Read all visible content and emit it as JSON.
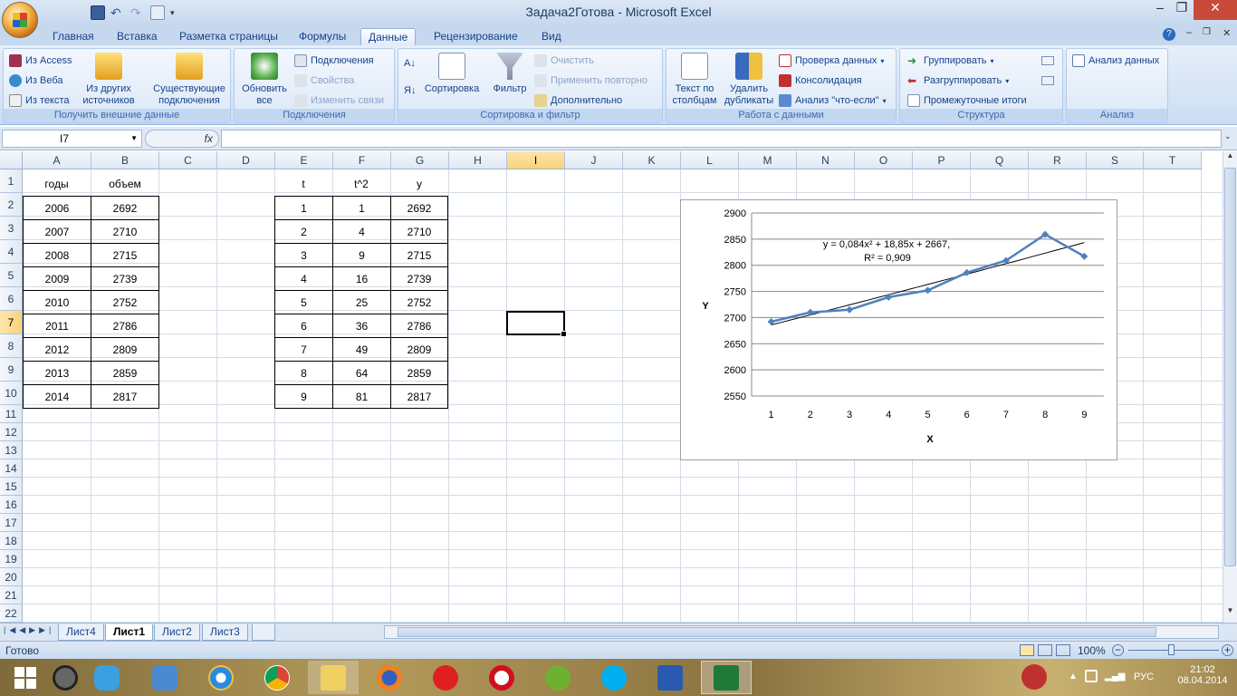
{
  "title": "Задача2Готова - Microsoft Excel",
  "tabs": [
    "Главная",
    "Вставка",
    "Разметка страницы",
    "Формулы",
    "Данные",
    "Рецензирование",
    "Вид"
  ],
  "active_tab": "Данные",
  "ribbon": {
    "ext": {
      "access": "Из Access",
      "web": "Из Веба",
      "text": "Из текста",
      "other1": "Из других",
      "other2": "источников",
      "exist1": "Существующие",
      "exist2": "подключения",
      "label": "Получить внешние данные"
    },
    "conn": {
      "refresh1": "Обновить",
      "refresh2": "все",
      "connections": "Подключения",
      "props": "Свойства",
      "edit": "Изменить связи",
      "label": "Подключения"
    },
    "sort": {
      "sort": "Сортировка",
      "filter": "Фильтр",
      "clear": "Очистить",
      "reapply": "Применить повторно",
      "advanced": "Дополнительно",
      "label": "Сортировка и фильтр"
    },
    "tools": {
      "ttc1": "Текст по",
      "ttc2": "столбцам",
      "dup1": "Удалить",
      "dup2": "дубликаты",
      "valid": "Проверка данных",
      "consol": "Консолидация",
      "whatif": "Анализ \"что-если\"",
      "label": "Работа с данными"
    },
    "outline": {
      "group": "Группировать",
      "ungroup": "Разгруппировать",
      "subtotal": "Промежуточные итоги",
      "label": "Структура"
    },
    "analysis": {
      "data": "Анализ данных",
      "label": "Анализ"
    }
  },
  "namebox": "I7",
  "fx": "fx",
  "columns": [
    "A",
    "B",
    "C",
    "D",
    "E",
    "F",
    "G",
    "H",
    "I",
    "J",
    "K",
    "L",
    "M",
    "N",
    "O",
    "P",
    "Q",
    "R",
    "S",
    "T"
  ],
  "selected_col": "I",
  "rows": [
    "1",
    "2",
    "3",
    "4",
    "5",
    "6",
    "7",
    "8",
    "9",
    "10",
    "11",
    "12",
    "13",
    "14",
    "15",
    "16",
    "17",
    "18",
    "19",
    "20",
    "21",
    "22"
  ],
  "selected_row": "7",
  "table1": {
    "headers": [
      "годы",
      "объем"
    ],
    "rows": [
      [
        "2006",
        "2692"
      ],
      [
        "2007",
        "2710"
      ],
      [
        "2008",
        "2715"
      ],
      [
        "2009",
        "2739"
      ],
      [
        "2010",
        "2752"
      ],
      [
        "2011",
        "2786"
      ],
      [
        "2012",
        "2809"
      ],
      [
        "2013",
        "2859"
      ],
      [
        "2014",
        "2817"
      ]
    ]
  },
  "table2": {
    "headers": [
      "t",
      "t^2",
      "y"
    ],
    "rows": [
      [
        "1",
        "1",
        "2692"
      ],
      [
        "2",
        "4",
        "2710"
      ],
      [
        "3",
        "9",
        "2715"
      ],
      [
        "4",
        "16",
        "2739"
      ],
      [
        "5",
        "25",
        "2752"
      ],
      [
        "6",
        "36",
        "2786"
      ],
      [
        "7",
        "49",
        "2809"
      ],
      [
        "8",
        "64",
        "2859"
      ],
      [
        "9",
        "81",
        "2817"
      ]
    ]
  },
  "chart_data": {
    "type": "line",
    "x": [
      1,
      2,
      3,
      4,
      5,
      6,
      7,
      8,
      9
    ],
    "series": [
      {
        "values": [
          2692,
          2710,
          2715,
          2739,
          2752,
          2786,
          2809,
          2859,
          2817
        ],
        "color": "#4f81bd"
      }
    ],
    "trendline": {
      "equation": "y = 0,084x² + 18,85x + 2667,",
      "r2": "R² = 0,909"
    },
    "xlabel": "X",
    "ylabel": "Y",
    "ylim": [
      2550,
      2900
    ],
    "yticks": [
      "2900",
      "2850",
      "2800",
      "2750",
      "2700",
      "2650",
      "2600",
      "2550"
    ],
    "xticks": [
      "1",
      "2",
      "3",
      "4",
      "5",
      "6",
      "7",
      "8",
      "9"
    ],
    "grid": true
  },
  "sheets": [
    "Лист4",
    "Лист1",
    "Лист2",
    "Лист3"
  ],
  "active_sheet": "Лист1",
  "status": "Готово",
  "zoom": "100%",
  "tray": {
    "lang": "РУС",
    "time": "21:02",
    "date": "08.04.2014"
  }
}
